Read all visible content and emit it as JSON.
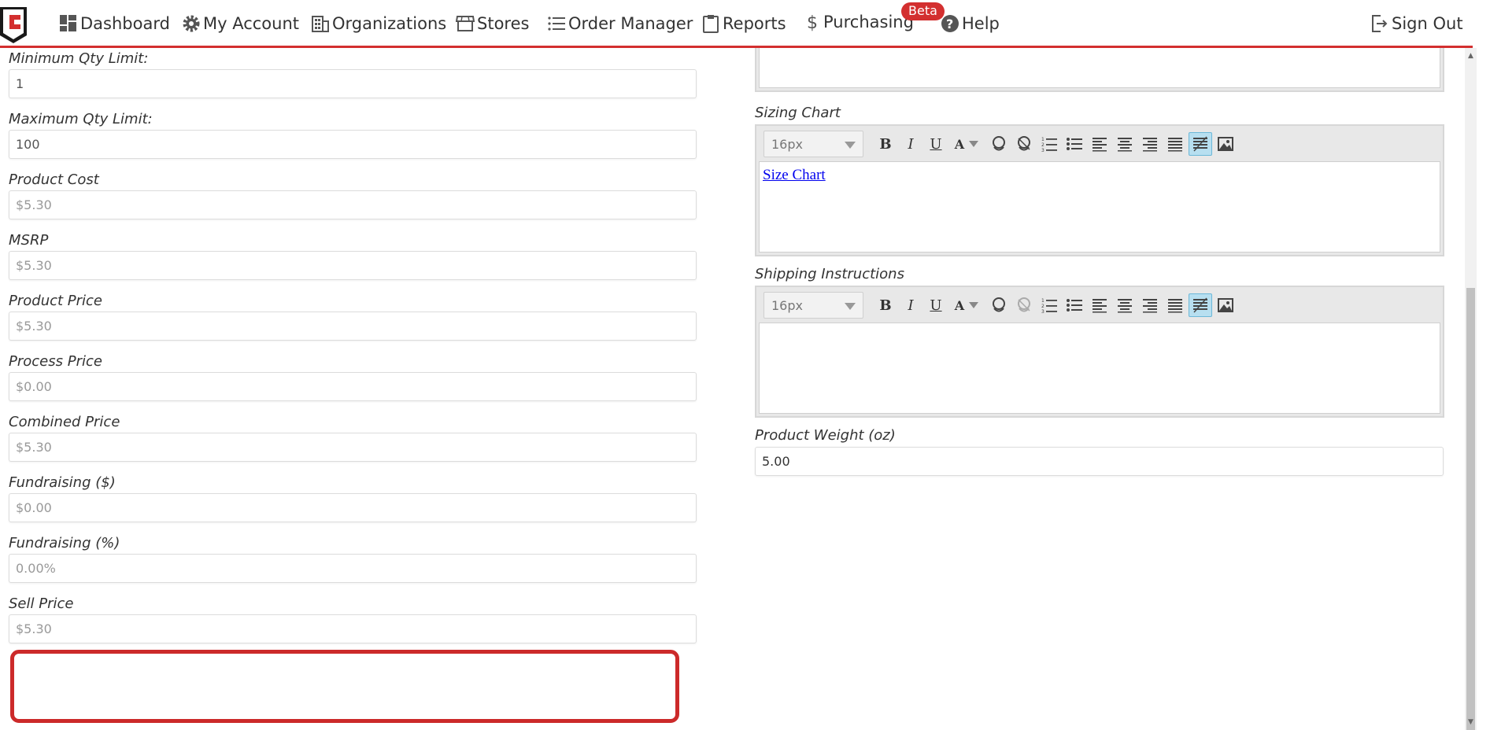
{
  "nav": {
    "items": [
      {
        "label": "Dashboard",
        "icon": "dashboard-icon"
      },
      {
        "label": "My Account",
        "icon": "gear-icon"
      },
      {
        "label": "Organizations",
        "icon": "building-icon"
      },
      {
        "label": "Stores",
        "icon": "store-icon"
      },
      {
        "label": "Order Manager",
        "icon": "list-icon"
      },
      {
        "label": "Reports",
        "icon": "clipboard-icon"
      },
      {
        "label": "Purchasing",
        "icon": "dollar-icon"
      },
      {
        "label": "Help",
        "icon": "question-icon"
      }
    ],
    "beta_badge": "Beta",
    "sign_out": "Sign Out",
    "accent_color": "#d32f2f"
  },
  "left_fields": [
    {
      "label": "Minimum Qty Limit:",
      "value": "1",
      "editable": true
    },
    {
      "label": "Maximum Qty Limit:",
      "value": "100",
      "editable": true
    },
    {
      "label": "Product Cost",
      "value": "$5.30",
      "editable": false
    },
    {
      "label": "MSRP",
      "value": "$5.30",
      "editable": false
    },
    {
      "label": "Product Price",
      "value": "$5.30",
      "editable": false
    },
    {
      "label": "Process Price",
      "value": "$0.00",
      "editable": false
    },
    {
      "label": "Combined Price",
      "value": "$5.30",
      "editable": false
    },
    {
      "label": "Fundraising ($)",
      "value": "$0.00",
      "editable": false
    },
    {
      "label": "Fundraising (%)",
      "value": "0.00%",
      "editable": false
    },
    {
      "label": "Sell Price",
      "value": "$5.30",
      "editable": false
    }
  ],
  "sizing_chart": {
    "label": "Sizing Chart",
    "font_size": "16px",
    "content_link": "Size Chart"
  },
  "shipping_instructions": {
    "label": "Shipping Instructions",
    "font_size": "16px",
    "content": ""
  },
  "product_weight": {
    "label": "Product Weight (oz)",
    "value": "5.00"
  },
  "highlight_color": "#cc2a2a"
}
